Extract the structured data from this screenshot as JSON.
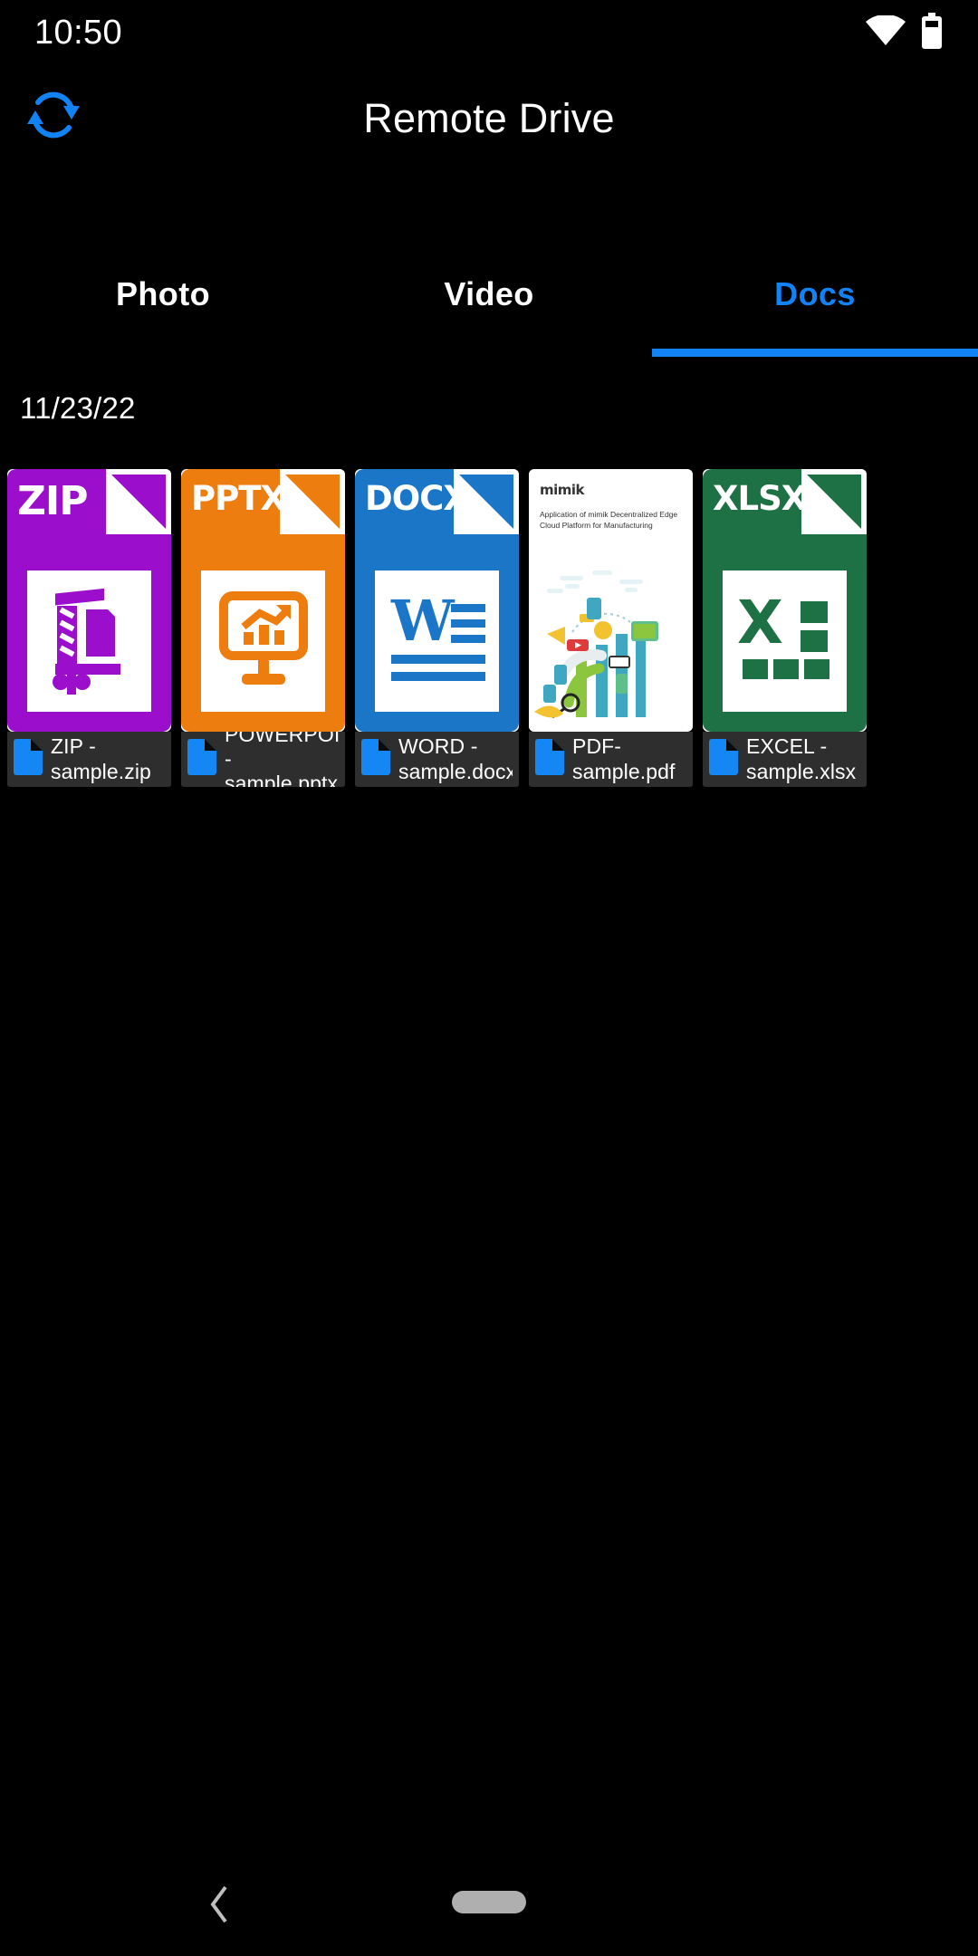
{
  "status_bar": {
    "clock": "10:50",
    "wifi_icon": "wifi-icon",
    "battery_icon": "battery-icon"
  },
  "app_bar": {
    "title": "Remote Drive",
    "sync_icon": "sync-refresh-icon"
  },
  "tabs": [
    {
      "label": "Photo",
      "active": false
    },
    {
      "label": "Video",
      "active": false
    },
    {
      "label": "Docs",
      "active": true
    }
  ],
  "date_header": "11/23/22",
  "files": [
    {
      "label": "ZIP - sample.zip",
      "kind": "tile",
      "ext": "ZIP",
      "color": "#9B0FCC",
      "glyph": "zip-compress-icon",
      "doc_icon": "blue-document-icon"
    },
    {
      "label": "POWERPOINT - sample.pptx",
      "kind": "tile",
      "ext": "PPTX",
      "color": "#ED7D0E",
      "glyph": "presentation-chart-icon",
      "doc_icon": "blue-document-icon"
    },
    {
      "label": "WORD - sample.docx",
      "kind": "tile",
      "ext": "DOCX",
      "color": "#1B76C8",
      "glyph": "word-w-icon",
      "doc_icon": "blue-document-icon"
    },
    {
      "label": "PDF-sample.pdf",
      "kind": "page",
      "logo": "mimik",
      "title": "Application of mimik Decentralized Edge Cloud Platform for Manufacturing",
      "doc_icon": "blue-document-icon"
    },
    {
      "label": "EXCEL - sample.xlsx",
      "kind": "tile",
      "ext": "XLSX",
      "color": "#1E7145",
      "glyph": "excel-x-icon",
      "doc_icon": "blue-document-icon"
    }
  ],
  "nav_bar": {
    "back_icon": "back-chevron-icon",
    "home_icon": "home-pill-icon"
  },
  "colors": {
    "accent": "#1283F4",
    "doc_icon": "#1587F5",
    "label_bg": "#2E2E2E",
    "background": "#000000"
  }
}
